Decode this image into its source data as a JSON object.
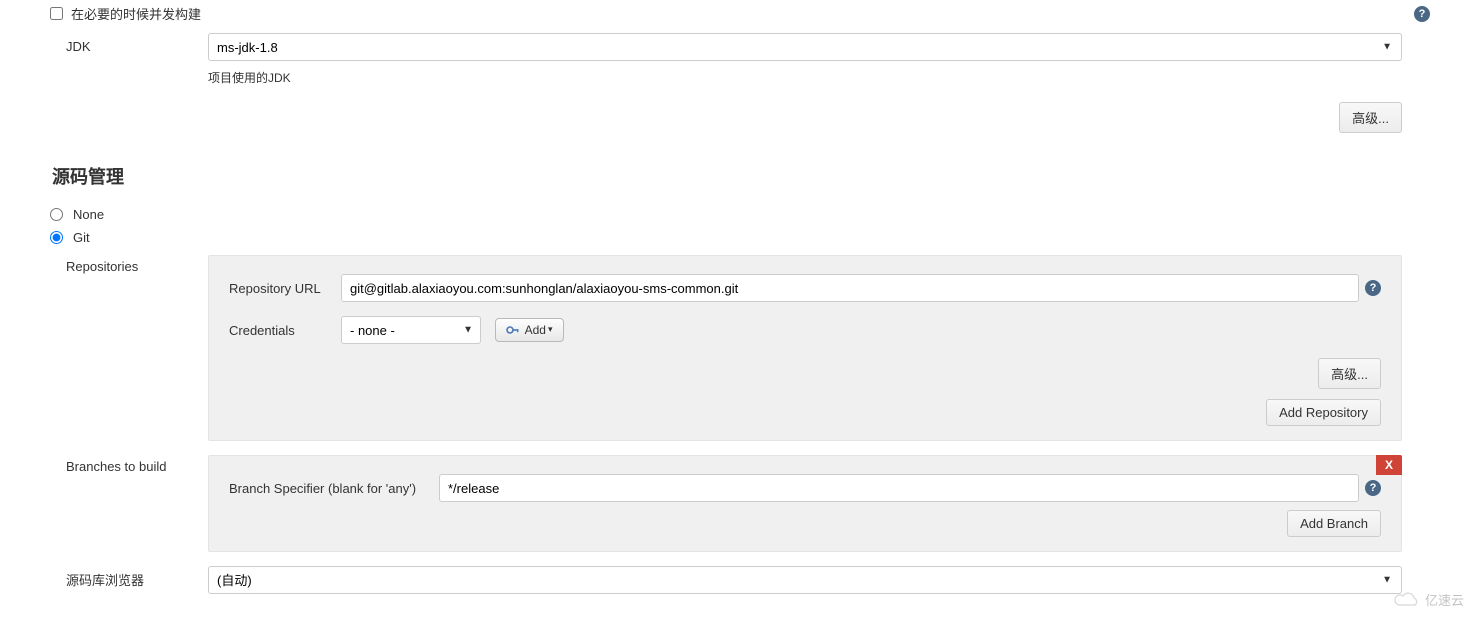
{
  "general": {
    "concurrent_build_label": "在必要的时候并发构建",
    "jdk_label": "JDK",
    "jdk_selected": "ms-jdk-1.8",
    "jdk_hint": "项目使用的JDK",
    "advanced_button": "高级..."
  },
  "scm": {
    "heading": "源码管理",
    "none_label": "None",
    "git_label": "Git",
    "selected": "git",
    "repositories_label": "Repositories",
    "repo": {
      "url_label": "Repository URL",
      "url_value": "git@gitlab.alaxiaoyou.com:sunhonglan/alaxiaoyou-sms-common.git",
      "credentials_label": "Credentials",
      "credentials_selected": "- none -",
      "add_label": "Add",
      "advanced_button": "高级...",
      "add_repo_button": "Add Repository"
    },
    "branches_label": "Branches to build",
    "branch": {
      "specifier_label": "Branch Specifier (blank for 'any')",
      "specifier_value": "*/release",
      "add_branch_button": "Add Branch",
      "delete_label": "X"
    },
    "browser_label": "源码库浏览器",
    "browser_selected": "(自动)"
  },
  "help_glyph": "?",
  "watermark": "亿速云"
}
